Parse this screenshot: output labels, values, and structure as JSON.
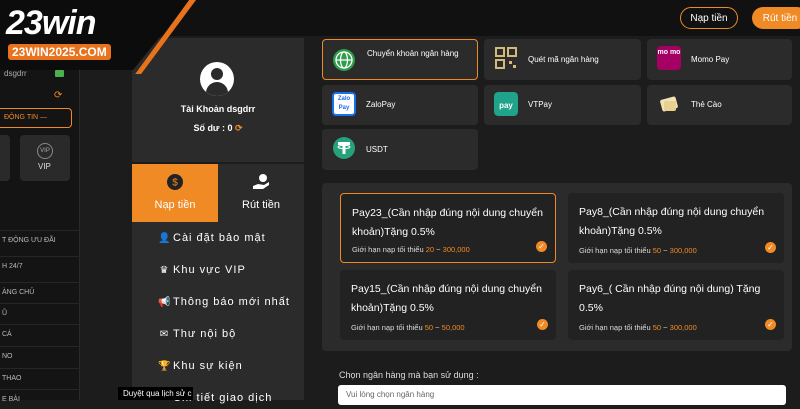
{
  "header": {
    "logo_main": "23win",
    "logo_sub": "23WIN2025.COM",
    "deposit_label": "Nạp tiền",
    "withdraw_label": "Rút tiền"
  },
  "sidebar": {
    "username": "dsgdrr",
    "select_label": "ĐỘNG TIN —",
    "vip_label": "VIP",
    "items": [
      "T ĐỘNG ƯU ĐÃI",
      "H 24/7",
      "ÀNG CHỦ",
      "Ũ",
      "CÁ",
      "NO",
      "THAO",
      "E BÀI"
    ]
  },
  "account": {
    "name": "Tài Khoản dsgdrr",
    "balance_label": "Số dư :",
    "balance_value": "0",
    "tabs": {
      "deposit": "Nạp tiền",
      "withdraw": "Rút tiền"
    },
    "menu": [
      "Cài đặt bảo mật",
      "Khu vực VIP",
      "Thông báo mới nhất",
      "Thư nội bộ",
      "Khu sự kiện",
      "Chi tiết giao dịch"
    ]
  },
  "payment_methods": [
    {
      "label": "Chuyển khoản ngân hàng",
      "icon": "globe-icon"
    },
    {
      "label": "Quét mã ngân hàng",
      "icon": "qr-icon"
    },
    {
      "label": "Momo Pay",
      "icon": "momo-icon",
      "icon_text": "mo mo"
    },
    {
      "label": "ZaloPay",
      "icon": "zalopay-icon",
      "icon_text": "Zalo Pay"
    },
    {
      "label": "VTPay",
      "icon": "vtpay-icon"
    },
    {
      "label": "Thẻ Cào",
      "icon": "card-icon"
    },
    {
      "label": "USDT",
      "icon": "tether-icon"
    }
  ],
  "channels": [
    {
      "title": "Pay23_(Cần nhập đúng nội dung chuyển khoản)Tặng 0.5%",
      "limit_label": "Giới hạn nạp tối thiểu",
      "min": "20",
      "sep": "~",
      "max": "300,000"
    },
    {
      "title": "Pay8_(Cần nhập đúng nội dung chuyển khoản)Tặng 0.5%",
      "limit_label": "Giới hạn nạp tối thiểu",
      "min": "50",
      "sep": "~",
      "max": "300,000"
    },
    {
      "title": "Pay15_(Cần nhập đúng nội dung chuyển khoản)Tặng 0.5%",
      "limit_label": "Giới hạn nạp tối thiểu",
      "min": "50",
      "sep": "~",
      "max": "50,000"
    },
    {
      "title": "Pay6_( Cần nhập đúng nội dung) Tặng 0.5%",
      "limit_label": "Giới hạn nạp tối thiểu",
      "min": "50",
      "sep": "~",
      "max": "300,000"
    }
  ],
  "bank": {
    "label": "Chọn ngân hàng mà bạn sử dụng :",
    "placeholder": "Vui lòng chọn ngân hàng"
  },
  "tooltip": "Duyệt qua lịch sử c",
  "colors": {
    "accent": "#f08a24",
    "panel": "#2b2b2b",
    "background": "#1c1c1c"
  }
}
